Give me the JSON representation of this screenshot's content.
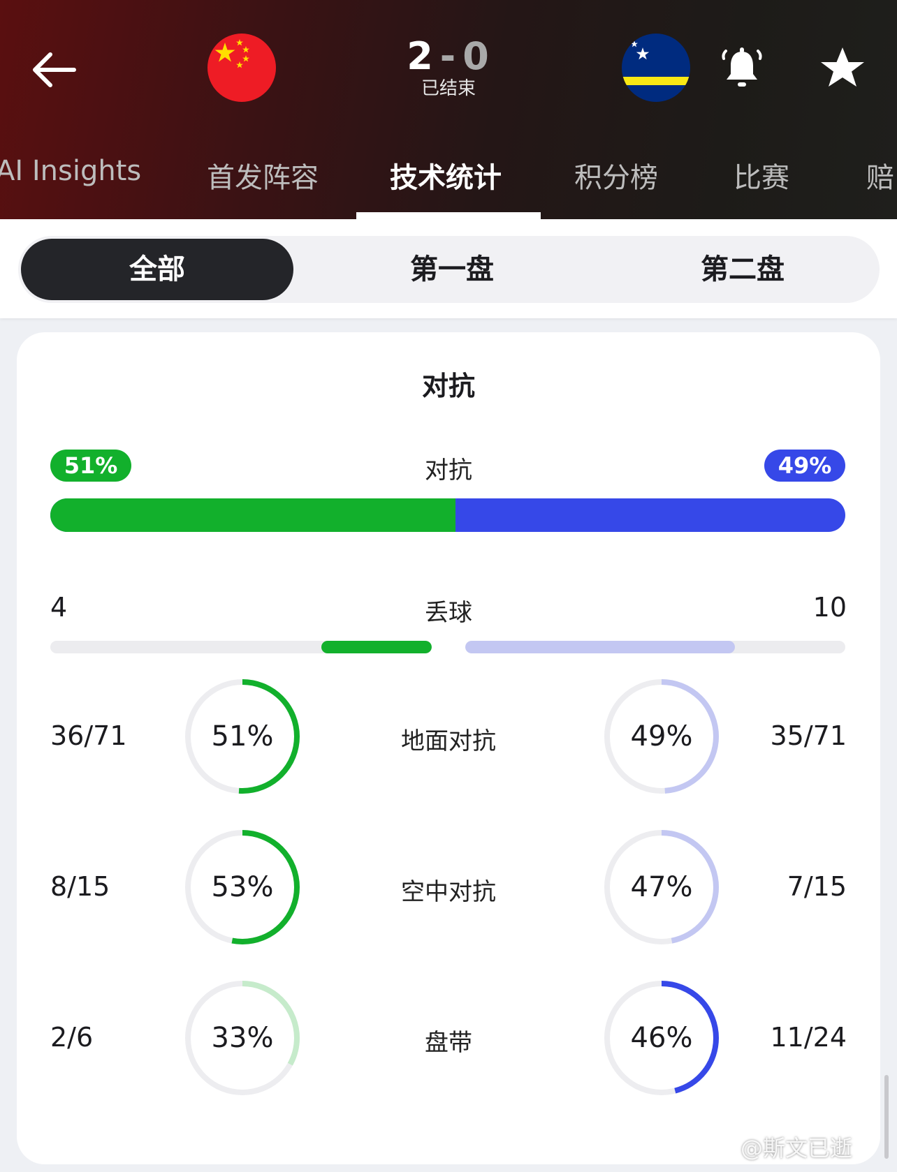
{
  "match": {
    "home_score": "2",
    "away_score": "0",
    "dash": "-",
    "status": "已结束"
  },
  "tabs": [
    {
      "label": "AI Insights"
    },
    {
      "label": "首发阵容"
    },
    {
      "label": "技术统计"
    },
    {
      "label": "积分榜"
    },
    {
      "label": "比赛"
    },
    {
      "label": "赔"
    }
  ],
  "segments": [
    {
      "label": "全部"
    },
    {
      "label": "第一盘"
    },
    {
      "label": "第二盘"
    }
  ],
  "card": {
    "title": "对抗",
    "duels": {
      "label": "对抗",
      "home_pct": "51%",
      "away_pct": "49%",
      "home_fraction": 0.51
    },
    "lost_ball": {
      "label": "丢球",
      "home": "4",
      "away": "10",
      "home_fraction": 0.29,
      "away_fraction": 0.71
    },
    "rings": [
      {
        "label": "地面对抗",
        "home_value": "36/71",
        "home_pct": "51%",
        "home_fraction": 0.51,
        "away_value": "35/71",
        "away_pct": "49%",
        "away_fraction": 0.49
      },
      {
        "label": "空中对抗",
        "home_value": "8/15",
        "home_pct": "53%",
        "home_fraction": 0.53,
        "away_value": "7/15",
        "away_pct": "47%",
        "away_fraction": 0.47
      },
      {
        "label": "盘带",
        "home_value": "2/6",
        "home_pct": "33%",
        "home_fraction": 0.33,
        "away_value": "11/24",
        "away_pct": "46%",
        "away_fraction": 0.46
      }
    ]
  },
  "colors": {
    "home_green": "#12b02c",
    "home_green_light": "#c6ebcb",
    "away_blue": "#3648e8",
    "away_blue_light": "#c3c7f2",
    "track": "#ededf0"
  },
  "icons": {
    "back": "back-arrow-icon",
    "bell": "bell-icon",
    "star": "star-icon"
  },
  "watermark": "@斯文已逝"
}
